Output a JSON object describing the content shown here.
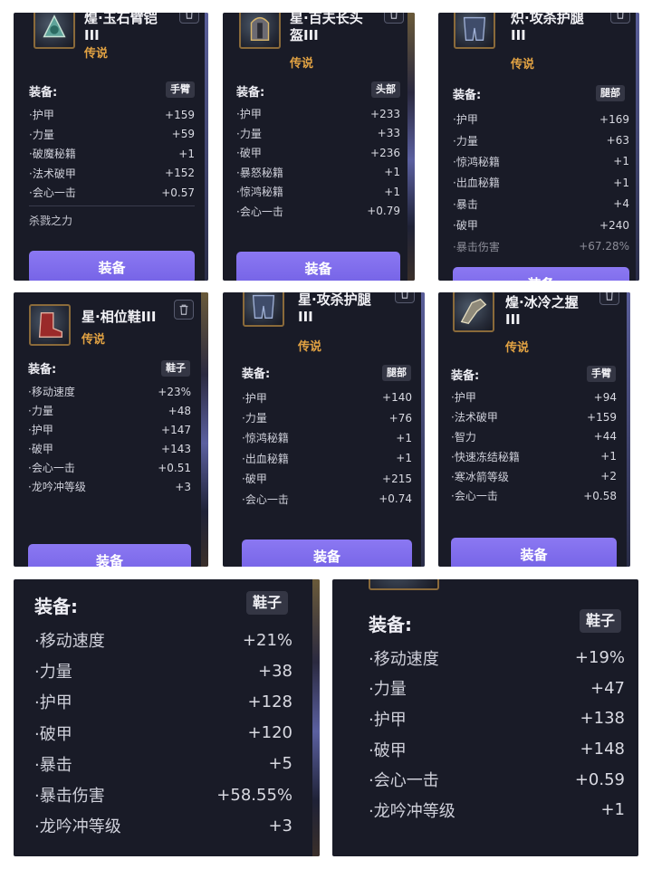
{
  "common": {
    "equip_label": "装备:",
    "equip_button": "装备",
    "rarity": "传说"
  },
  "panels": [
    {
      "name_line1": "煌·玉石臂铠",
      "name_line2": "III",
      "slot": "手臂",
      "stats": [
        {
          "label": "·护甲",
          "value": "+159"
        },
        {
          "label": "·力量",
          "value": "+59"
        },
        {
          "label": "·破魔秘籍",
          "value": "+1"
        },
        {
          "label": "·法术破甲",
          "value": "+152"
        },
        {
          "label": "·会心一击",
          "value": "+0.57"
        }
      ],
      "set_name": "杀戮之力"
    },
    {
      "name_line1": "星·百夫长头",
      "name_line2": "盔III",
      "slot": "头部",
      "stats": [
        {
          "label": "·护甲",
          "value": "+233"
        },
        {
          "label": "·力量",
          "value": "+33"
        },
        {
          "label": "·破甲",
          "value": "+236"
        },
        {
          "label": "·暴怒秘籍",
          "value": "+1"
        },
        {
          "label": "·惊鸿秘籍",
          "value": "+1"
        },
        {
          "label": "·会心一击",
          "value": "+0.79"
        }
      ]
    },
    {
      "name_line1": "炽·攻杀护腿",
      "name_line2": "III",
      "slot": "腿部",
      "stats": [
        {
          "label": "·护甲",
          "value": "+169"
        },
        {
          "label": "·力量",
          "value": "+63"
        },
        {
          "label": "·惊鸿秘籍",
          "value": "+1"
        },
        {
          "label": "·出血秘籍",
          "value": "+1"
        },
        {
          "label": "·暴击",
          "value": "+4"
        },
        {
          "label": "·破甲",
          "value": "+240"
        },
        {
          "label": "·暴击伤害",
          "value": "+67.28%"
        }
      ]
    },
    {
      "name_line1": "星·相位鞋III",
      "slot": "鞋子",
      "stats": [
        {
          "label": "·移动速度",
          "value": "+23%"
        },
        {
          "label": "·力量",
          "value": "+48"
        },
        {
          "label": "·护甲",
          "value": "+147"
        },
        {
          "label": "·破甲",
          "value": "+143"
        },
        {
          "label": "·会心一击",
          "value": "+0.51"
        },
        {
          "label": "·龙吟冲等级",
          "value": "+3"
        }
      ]
    },
    {
      "name_line1": "星·攻杀护腿",
      "name_line2": "III",
      "slot": "腿部",
      "stats": [
        {
          "label": "·护甲",
          "value": "+140"
        },
        {
          "label": "·力量",
          "value": "+76"
        },
        {
          "label": "·惊鸿秘籍",
          "value": "+1"
        },
        {
          "label": "·出血秘籍",
          "value": "+1"
        },
        {
          "label": "·破甲",
          "value": "+215"
        },
        {
          "label": "·会心一击",
          "value": "+0.74"
        }
      ]
    },
    {
      "name_line1": "煌·冰冷之握",
      "name_line2": "III",
      "slot": "手臂",
      "stats": [
        {
          "label": "·护甲",
          "value": "+94"
        },
        {
          "label": "·法术破甲",
          "value": "+159"
        },
        {
          "label": "·智力",
          "value": "+44"
        },
        {
          "label": "·快速冻结秘籍",
          "value": "+1"
        },
        {
          "label": "·寒冰箭等级",
          "value": "+2"
        },
        {
          "label": "·会心一击",
          "value": "+0.58"
        }
      ]
    },
    {
      "slot": "鞋子",
      "stats": [
        {
          "label": "·移动速度",
          "value": "+21%"
        },
        {
          "label": "·力量",
          "value": "+38"
        },
        {
          "label": "·护甲",
          "value": "+128"
        },
        {
          "label": "·破甲",
          "value": "+120"
        },
        {
          "label": "·暴击",
          "value": "+5"
        },
        {
          "label": "·暴击伤害",
          "value": "+58.55%"
        },
        {
          "label": "·龙吟冲等级",
          "value": "+3"
        }
      ]
    },
    {
      "slot": "鞋子",
      "stats": [
        {
          "label": "·移动速度",
          "value": "+19%"
        },
        {
          "label": "·力量",
          "value": "+47"
        },
        {
          "label": "·护甲",
          "value": "+138"
        },
        {
          "label": "·破甲",
          "value": "+148"
        },
        {
          "label": "·会心一击",
          "value": "+0.59"
        },
        {
          "label": "·龙吟冲等级",
          "value": "+1"
        }
      ]
    }
  ]
}
